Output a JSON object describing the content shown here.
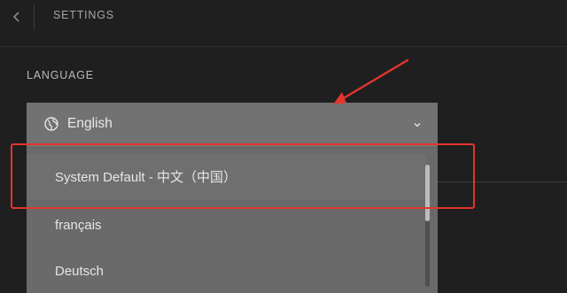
{
  "header": {
    "title": "SETTINGS",
    "back_icon": "chevron-left-icon"
  },
  "language": {
    "section_label": "LANGUAGE",
    "selected_value": "English",
    "value_icon": "globe-icon",
    "dropdown_icon": "chevron-down-icon",
    "options": [
      {
        "label": "System Default - 中文（中国）",
        "highlighted": true
      },
      {
        "label": "français",
        "highlighted": false
      },
      {
        "label": "Deutsch",
        "highlighted": false
      }
    ]
  },
  "annotation": {
    "color": "#e3342f",
    "shapes": [
      "arrow-icon",
      "highlight-box"
    ]
  }
}
